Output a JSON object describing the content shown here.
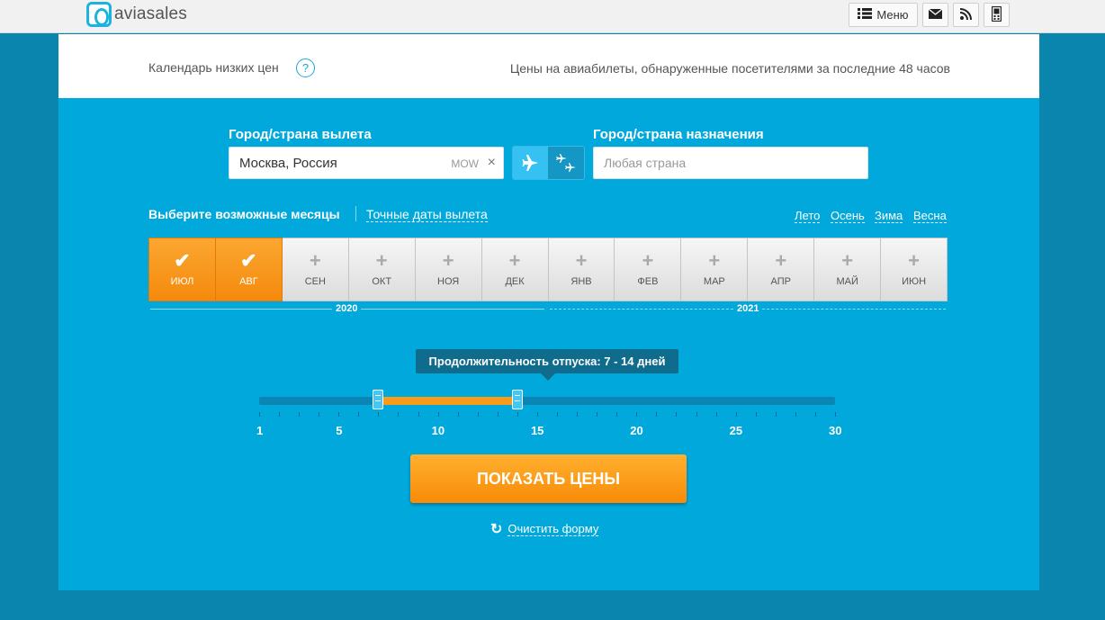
{
  "topbar": {
    "logo_text": "aviasales",
    "menu_label": "Меню",
    "icons": [
      "menu-list-icon",
      "mail-icon",
      "rss-icon",
      "mobile-icon"
    ]
  },
  "header": {
    "title": "Календарь низких цен",
    "help": "?",
    "note": "Цены на авиабилеты, обнаруженные посетителями за последние 48 часов"
  },
  "search": {
    "from_label": "Город/страна вылета",
    "from_value": "Москва, Россия",
    "from_code": "MOW",
    "clear": "×",
    "to_label": "Город/страна назначения",
    "to_placeholder": "Любая страна"
  },
  "months_section": {
    "title": "Выберите возможные месяцы",
    "exact_link": "Точные даты вылета",
    "seasons": [
      "Лето",
      "Осень",
      "Зима",
      "Весна"
    ],
    "months": [
      {
        "label": "ИЮЛ",
        "selected": true
      },
      {
        "label": "АВГ",
        "selected": true
      },
      {
        "label": "СЕН",
        "selected": false
      },
      {
        "label": "ОКТ",
        "selected": false
      },
      {
        "label": "НОЯ",
        "selected": false
      },
      {
        "label": "ДЕК",
        "selected": false
      },
      {
        "label": "ЯНВ",
        "selected": false
      },
      {
        "label": "ФЕВ",
        "selected": false
      },
      {
        "label": "МАР",
        "selected": false
      },
      {
        "label": "АПР",
        "selected": false
      },
      {
        "label": "МАЙ",
        "selected": false
      },
      {
        "label": "ИЮН",
        "selected": false
      }
    ],
    "years": [
      "2020",
      "2021"
    ]
  },
  "duration": {
    "tooltip": "Продолжительность отпуска: 7 - 14 дней",
    "min": 1,
    "max": 30,
    "from": 7,
    "to": 14,
    "scale": [
      "1",
      "5",
      "10",
      "15",
      "20",
      "25",
      "30"
    ]
  },
  "actions": {
    "show_prices": "ПОКАЗАТЬ ЦЕНЫ",
    "clear_form": "Очистить форму"
  },
  "colors": {
    "accent": "#00a8dc",
    "orange": "#f88b08",
    "background": "#0a86ae"
  }
}
